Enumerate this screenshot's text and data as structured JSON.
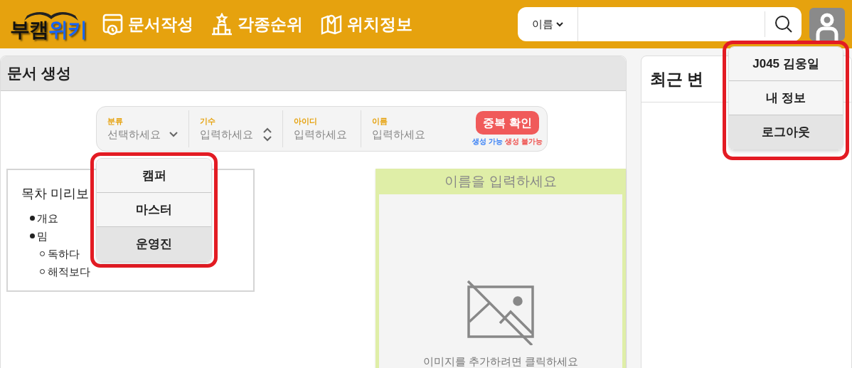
{
  "header": {
    "logo": [
      "부캠",
      "위키"
    ],
    "nav": [
      {
        "label": "문서작성"
      },
      {
        "label": "각종순위"
      },
      {
        "label": "위치정보"
      }
    ],
    "search": {
      "scope": "이름"
    }
  },
  "user_menu": {
    "items": [
      {
        "label": "J045 김웅일",
        "selected": false
      },
      {
        "label": "내 정보",
        "selected": false
      },
      {
        "label": "로그아웃",
        "selected": true
      }
    ]
  },
  "create_panel": {
    "title": "문서 생성",
    "fields": [
      {
        "label": "분류",
        "placeholder": "선택하세요",
        "kind": "select"
      },
      {
        "label": "기수",
        "placeholder": "입력하세요",
        "kind": "number"
      },
      {
        "label": "아이디",
        "placeholder": "입력하세요",
        "kind": "text"
      },
      {
        "label": "이름",
        "placeholder": "입력하세요",
        "kind": "text"
      }
    ],
    "check_button": "중복 확인",
    "legend": [
      {
        "label": "생성 가능",
        "color": "#3b82f6"
      },
      {
        "label": "생성 불가능",
        "color": "#ef5350"
      }
    ],
    "category_menu": {
      "items": [
        {
          "label": "캠퍼",
          "selected": false
        },
        {
          "label": "마스터",
          "selected": false
        },
        {
          "label": "운영진",
          "selected": true
        }
      ]
    },
    "toc": {
      "title": "목차 미리보",
      "items": [
        {
          "label": "개요"
        },
        {
          "label": "밈",
          "children": [
            {
              "label": "독하다"
            },
            {
              "label": "해적보다"
            }
          ]
        }
      ]
    },
    "profile_card": {
      "name_placeholder": "이름을 입력하세요",
      "image_hint": "이미지를 추가하려면 클릭하세요"
    }
  },
  "recent_panel": {
    "title": "최근 변"
  }
}
